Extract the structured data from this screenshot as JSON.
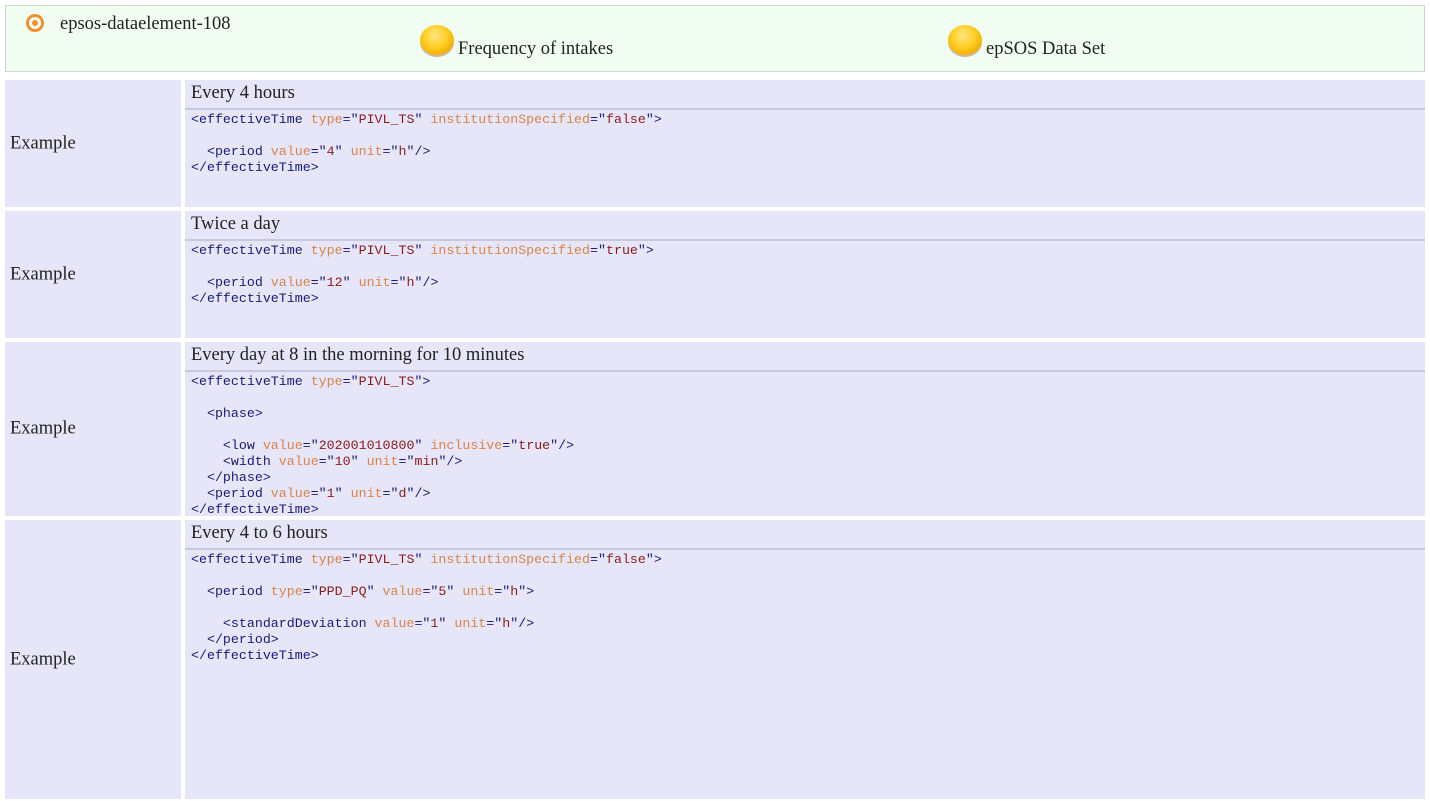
{
  "header": {
    "id": "epsos-dataelement-108",
    "name": "Frequency of intakes",
    "dataset": "epSOS Data Set",
    "icons": [
      "target-icon",
      "yellow-ball-icon",
      "yellow-ball-icon"
    ]
  },
  "examples": [
    {
      "label": "Example",
      "title": "Every 4 hours",
      "code": [
        [
          [
            "t",
            "<effectiveTime "
          ],
          [
            "a",
            "type"
          ],
          [
            "t",
            "=\""
          ],
          [
            "v",
            "PIVL_TS"
          ],
          [
            "t",
            "\" "
          ],
          [
            "a",
            "institutionSpecified"
          ],
          [
            "t",
            "=\""
          ],
          [
            "v",
            "false"
          ],
          [
            "t",
            "\">"
          ]
        ],
        [],
        [
          [
            "t",
            "  <period "
          ],
          [
            "a",
            "value"
          ],
          [
            "t",
            "=\""
          ],
          [
            "v",
            "4"
          ],
          [
            "t",
            "\" "
          ],
          [
            "a",
            "unit"
          ],
          [
            "t",
            "=\""
          ],
          [
            "v",
            "h"
          ],
          [
            "t",
            "\"/>"
          ]
        ],
        [
          [
            "t",
            "</effectiveTime>"
          ]
        ]
      ]
    },
    {
      "label": "Example",
      "title": "Twice a day",
      "code": [
        [
          [
            "t",
            "<effectiveTime "
          ],
          [
            "a",
            "type"
          ],
          [
            "t",
            "=\""
          ],
          [
            "v",
            "PIVL_TS"
          ],
          [
            "t",
            "\" "
          ],
          [
            "a",
            "institutionSpecified"
          ],
          [
            "t",
            "=\""
          ],
          [
            "v",
            "true"
          ],
          [
            "t",
            "\">"
          ]
        ],
        [],
        [
          [
            "t",
            "  <period "
          ],
          [
            "a",
            "value"
          ],
          [
            "t",
            "=\""
          ],
          [
            "v",
            "12"
          ],
          [
            "t",
            "\" "
          ],
          [
            "a",
            "unit"
          ],
          [
            "t",
            "=\""
          ],
          [
            "v",
            "h"
          ],
          [
            "t",
            "\"/>"
          ]
        ],
        [
          [
            "t",
            "</effectiveTime>"
          ]
        ]
      ]
    },
    {
      "label": "Example",
      "title": "Every day at 8 in the morning for 10 minutes",
      "code": [
        [
          [
            "t",
            "<effectiveTime "
          ],
          [
            "a",
            "type"
          ],
          [
            "t",
            "=\""
          ],
          [
            "v",
            "PIVL_TS"
          ],
          [
            "t",
            "\">"
          ]
        ],
        [],
        [
          [
            "t",
            "  <phase>"
          ]
        ],
        [],
        [
          [
            "t",
            "    <low "
          ],
          [
            "a",
            "value"
          ],
          [
            "t",
            "=\""
          ],
          [
            "v",
            "202001010800"
          ],
          [
            "t",
            "\" "
          ],
          [
            "a",
            "inclusive"
          ],
          [
            "t",
            "=\""
          ],
          [
            "v",
            "true"
          ],
          [
            "t",
            "\"/>"
          ]
        ],
        [
          [
            "t",
            "    <width "
          ],
          [
            "a",
            "value"
          ],
          [
            "t",
            "=\""
          ],
          [
            "v",
            "10"
          ],
          [
            "t",
            "\" "
          ],
          [
            "a",
            "unit"
          ],
          [
            "t",
            "=\""
          ],
          [
            "v",
            "min"
          ],
          [
            "t",
            "\"/>"
          ]
        ],
        [
          [
            "t",
            "  </phase>"
          ]
        ],
        [
          [
            "t",
            "  <period "
          ],
          [
            "a",
            "value"
          ],
          [
            "t",
            "=\""
          ],
          [
            "v",
            "1"
          ],
          [
            "t",
            "\" "
          ],
          [
            "a",
            "unit"
          ],
          [
            "t",
            "=\""
          ],
          [
            "v",
            "d"
          ],
          [
            "t",
            "\"/>"
          ]
        ],
        [
          [
            "t",
            "</effectiveTime>"
          ]
        ]
      ]
    },
    {
      "label": "Example",
      "title": "Every 4 to 6 hours",
      "code": [
        [
          [
            "t",
            "<effectiveTime "
          ],
          [
            "a",
            "type"
          ],
          [
            "t",
            "=\""
          ],
          [
            "v",
            "PIVL_TS"
          ],
          [
            "t",
            "\" "
          ],
          [
            "a",
            "institutionSpecified"
          ],
          [
            "t",
            "=\""
          ],
          [
            "v",
            "false"
          ],
          [
            "t",
            "\">"
          ]
        ],
        [],
        [
          [
            "t",
            "  <period "
          ],
          [
            "a",
            "type"
          ],
          [
            "t",
            "=\""
          ],
          [
            "v",
            "PPD_PQ"
          ],
          [
            "t",
            "\" "
          ],
          [
            "a",
            "value"
          ],
          [
            "t",
            "=\""
          ],
          [
            "v",
            "5"
          ],
          [
            "t",
            "\" "
          ],
          [
            "a",
            "unit"
          ],
          [
            "t",
            "=\""
          ],
          [
            "v",
            "h"
          ],
          [
            "t",
            "\">"
          ]
        ],
        [],
        [
          [
            "t",
            "    <standardDeviation "
          ],
          [
            "a",
            "value"
          ],
          [
            "t",
            "=\""
          ],
          [
            "v",
            "1"
          ],
          [
            "t",
            "\" "
          ],
          [
            "a",
            "unit"
          ],
          [
            "t",
            "=\""
          ],
          [
            "v",
            "h"
          ],
          [
            "t",
            "\"/>"
          ]
        ],
        [
          [
            "t",
            "  </period>"
          ]
        ],
        [
          [
            "t",
            "</effectiveTime>"
          ]
        ]
      ]
    }
  ]
}
